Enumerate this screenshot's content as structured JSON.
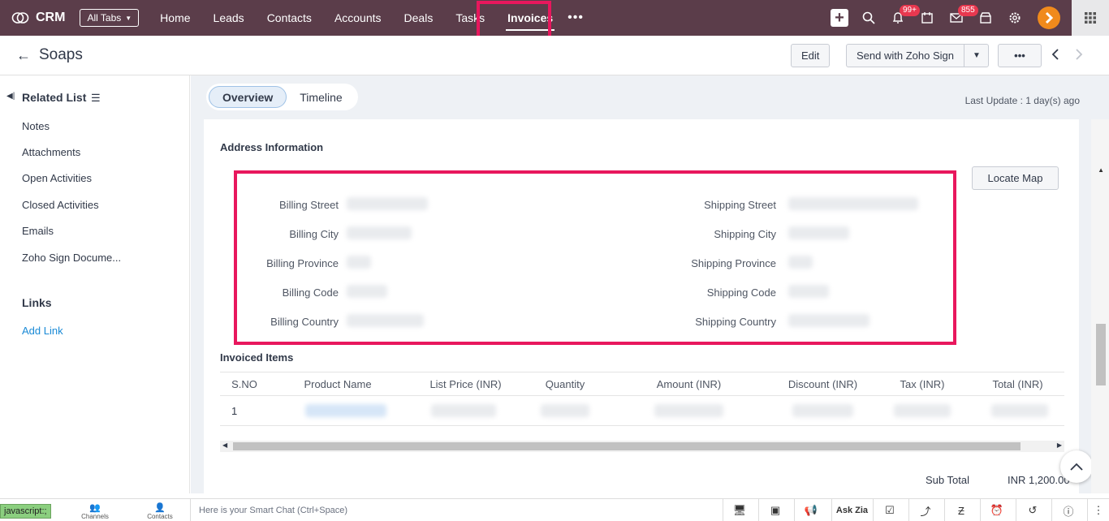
{
  "app": {
    "name": "CRM",
    "all_tabs": "All Tabs"
  },
  "nav": {
    "items": [
      "Home",
      "Leads",
      "Contacts",
      "Accounts",
      "Deals",
      "Tasks",
      "Invoices"
    ],
    "active": "Invoices",
    "more": "•••"
  },
  "nav_right": {
    "notif_badge": "99+",
    "mail_badge": "855"
  },
  "record": {
    "title": "Soaps",
    "edit_label": "Edit",
    "send_label": "Send with Zoho Sign",
    "more_label": "•••"
  },
  "sidebar": {
    "related_title": "Related List",
    "items": [
      "Notes",
      "Attachments",
      "Open Activities",
      "Closed Activities",
      "Emails",
      "Zoho Sign Docume..."
    ],
    "links_title": "Links",
    "add_link": "Add Link"
  },
  "tabs": {
    "overview": "Overview",
    "timeline": "Timeline"
  },
  "last_update": "Last Update : 1 day(s) ago",
  "address": {
    "section_title": "Address Information",
    "locate_map": "Locate Map",
    "billing": [
      "Billing Street",
      "Billing City",
      "Billing Province",
      "Billing Code",
      "Billing Country"
    ],
    "shipping": [
      "Shipping Street",
      "Shipping City",
      "Shipping Province",
      "Shipping Code",
      "Shipping Country"
    ]
  },
  "items": {
    "section_title": "Invoiced Items",
    "columns": [
      "S.NO",
      "Product Name",
      "List Price (INR)",
      "Quantity",
      "Amount (INR)",
      "Discount (INR)",
      "Tax (INR)",
      "Total (INR)"
    ],
    "row_sno": "1",
    "subtotal_label": "Sub Total",
    "subtotal_value": "INR 1,200.00"
  },
  "bottom": {
    "js": "javascript:;",
    "channels": "Channels",
    "contacts": "Contacts",
    "smartchat": "Here is your Smart Chat (Ctrl+Space)",
    "ask_zia": "Ask Zia"
  }
}
